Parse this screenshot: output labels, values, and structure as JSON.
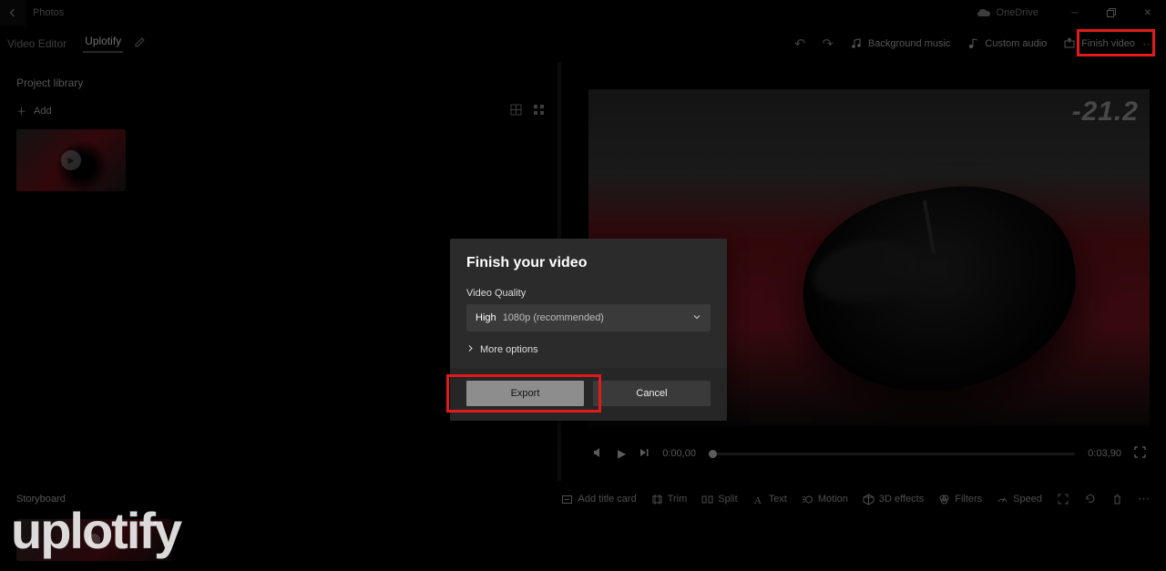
{
  "titlebar": {
    "app_name": "Photos",
    "cloud_label": "OneDrive"
  },
  "cmdbar": {
    "crumb": "Video Editor",
    "project_name": "Uplotify",
    "bg_music": "Background music",
    "custom_audio": "Custom audio",
    "finish_video": "Finish video"
  },
  "library": {
    "title": "Project library",
    "add_label": "Add"
  },
  "player": {
    "current_time": "0:00,00",
    "total_time": "0:03,90"
  },
  "preview": {
    "readout": "-21.2"
  },
  "storyboard": {
    "title": "Storyboard",
    "tools": {
      "add_title": "Add title card",
      "trim": "Trim",
      "split": "Split",
      "text": "Text",
      "motion": "Motion",
      "effects": "3D effects",
      "filters": "Filters",
      "speed": "Speed"
    }
  },
  "dialog": {
    "title": "Finish your video",
    "quality_label": "Video Quality",
    "quality_value_hi": "High",
    "quality_value_rest": "1080p (recommended)",
    "more_options": "More options",
    "export": "Export",
    "cancel": "Cancel"
  },
  "watermark": "uplotify"
}
